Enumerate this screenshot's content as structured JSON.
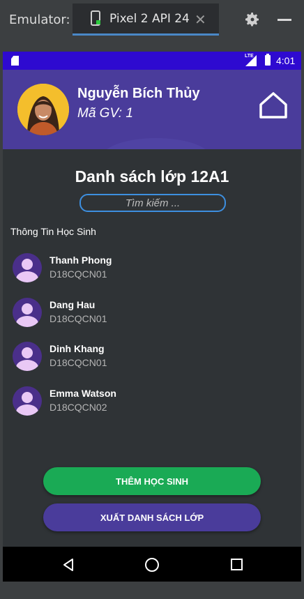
{
  "emulator": {
    "label": "Emulator:",
    "device_tab": "Pixel 2 API 24",
    "close_glyph": "✕"
  },
  "status_bar": {
    "network": "LTE",
    "time": "4:01"
  },
  "header": {
    "teacher_name": "Nguyễn Bích Thủy",
    "teacher_id": "Mã GV: 1"
  },
  "main": {
    "class_title": "Danh sách lớp 12A1",
    "search_placeholder": "Tìm kiếm ...",
    "section_label": "Thông Tin Học Sinh",
    "students": [
      {
        "name": "Thanh Phong",
        "code": "D18CQCN01"
      },
      {
        "name": "Dang Hau",
        "code": "D18CQCN01"
      },
      {
        "name": "Dinh Khang",
        "code": "D18CQCN01"
      },
      {
        "name": "Emma Watson",
        "code": "D18CQCN02"
      }
    ],
    "add_button": "THÊM HỌC SINH",
    "export_button": "XUẤT DANH SÁCH LỚP"
  },
  "colors": {
    "status_bar": "#2e0ad0",
    "header": "#4a3c9b",
    "add_button": "#1aaa55",
    "export_button": "#4a3c9b",
    "search_border": "#3d8fe0"
  },
  "icons": {
    "emulator_device": "phone-device-icon",
    "emulator_settings": "gear-icon",
    "emulator_minimize": "minimize-icon",
    "home": "home-icon",
    "nav_back": "back-triangle-icon",
    "nav_home": "home-circle-icon",
    "nav_recent": "recent-apps-square-icon"
  }
}
